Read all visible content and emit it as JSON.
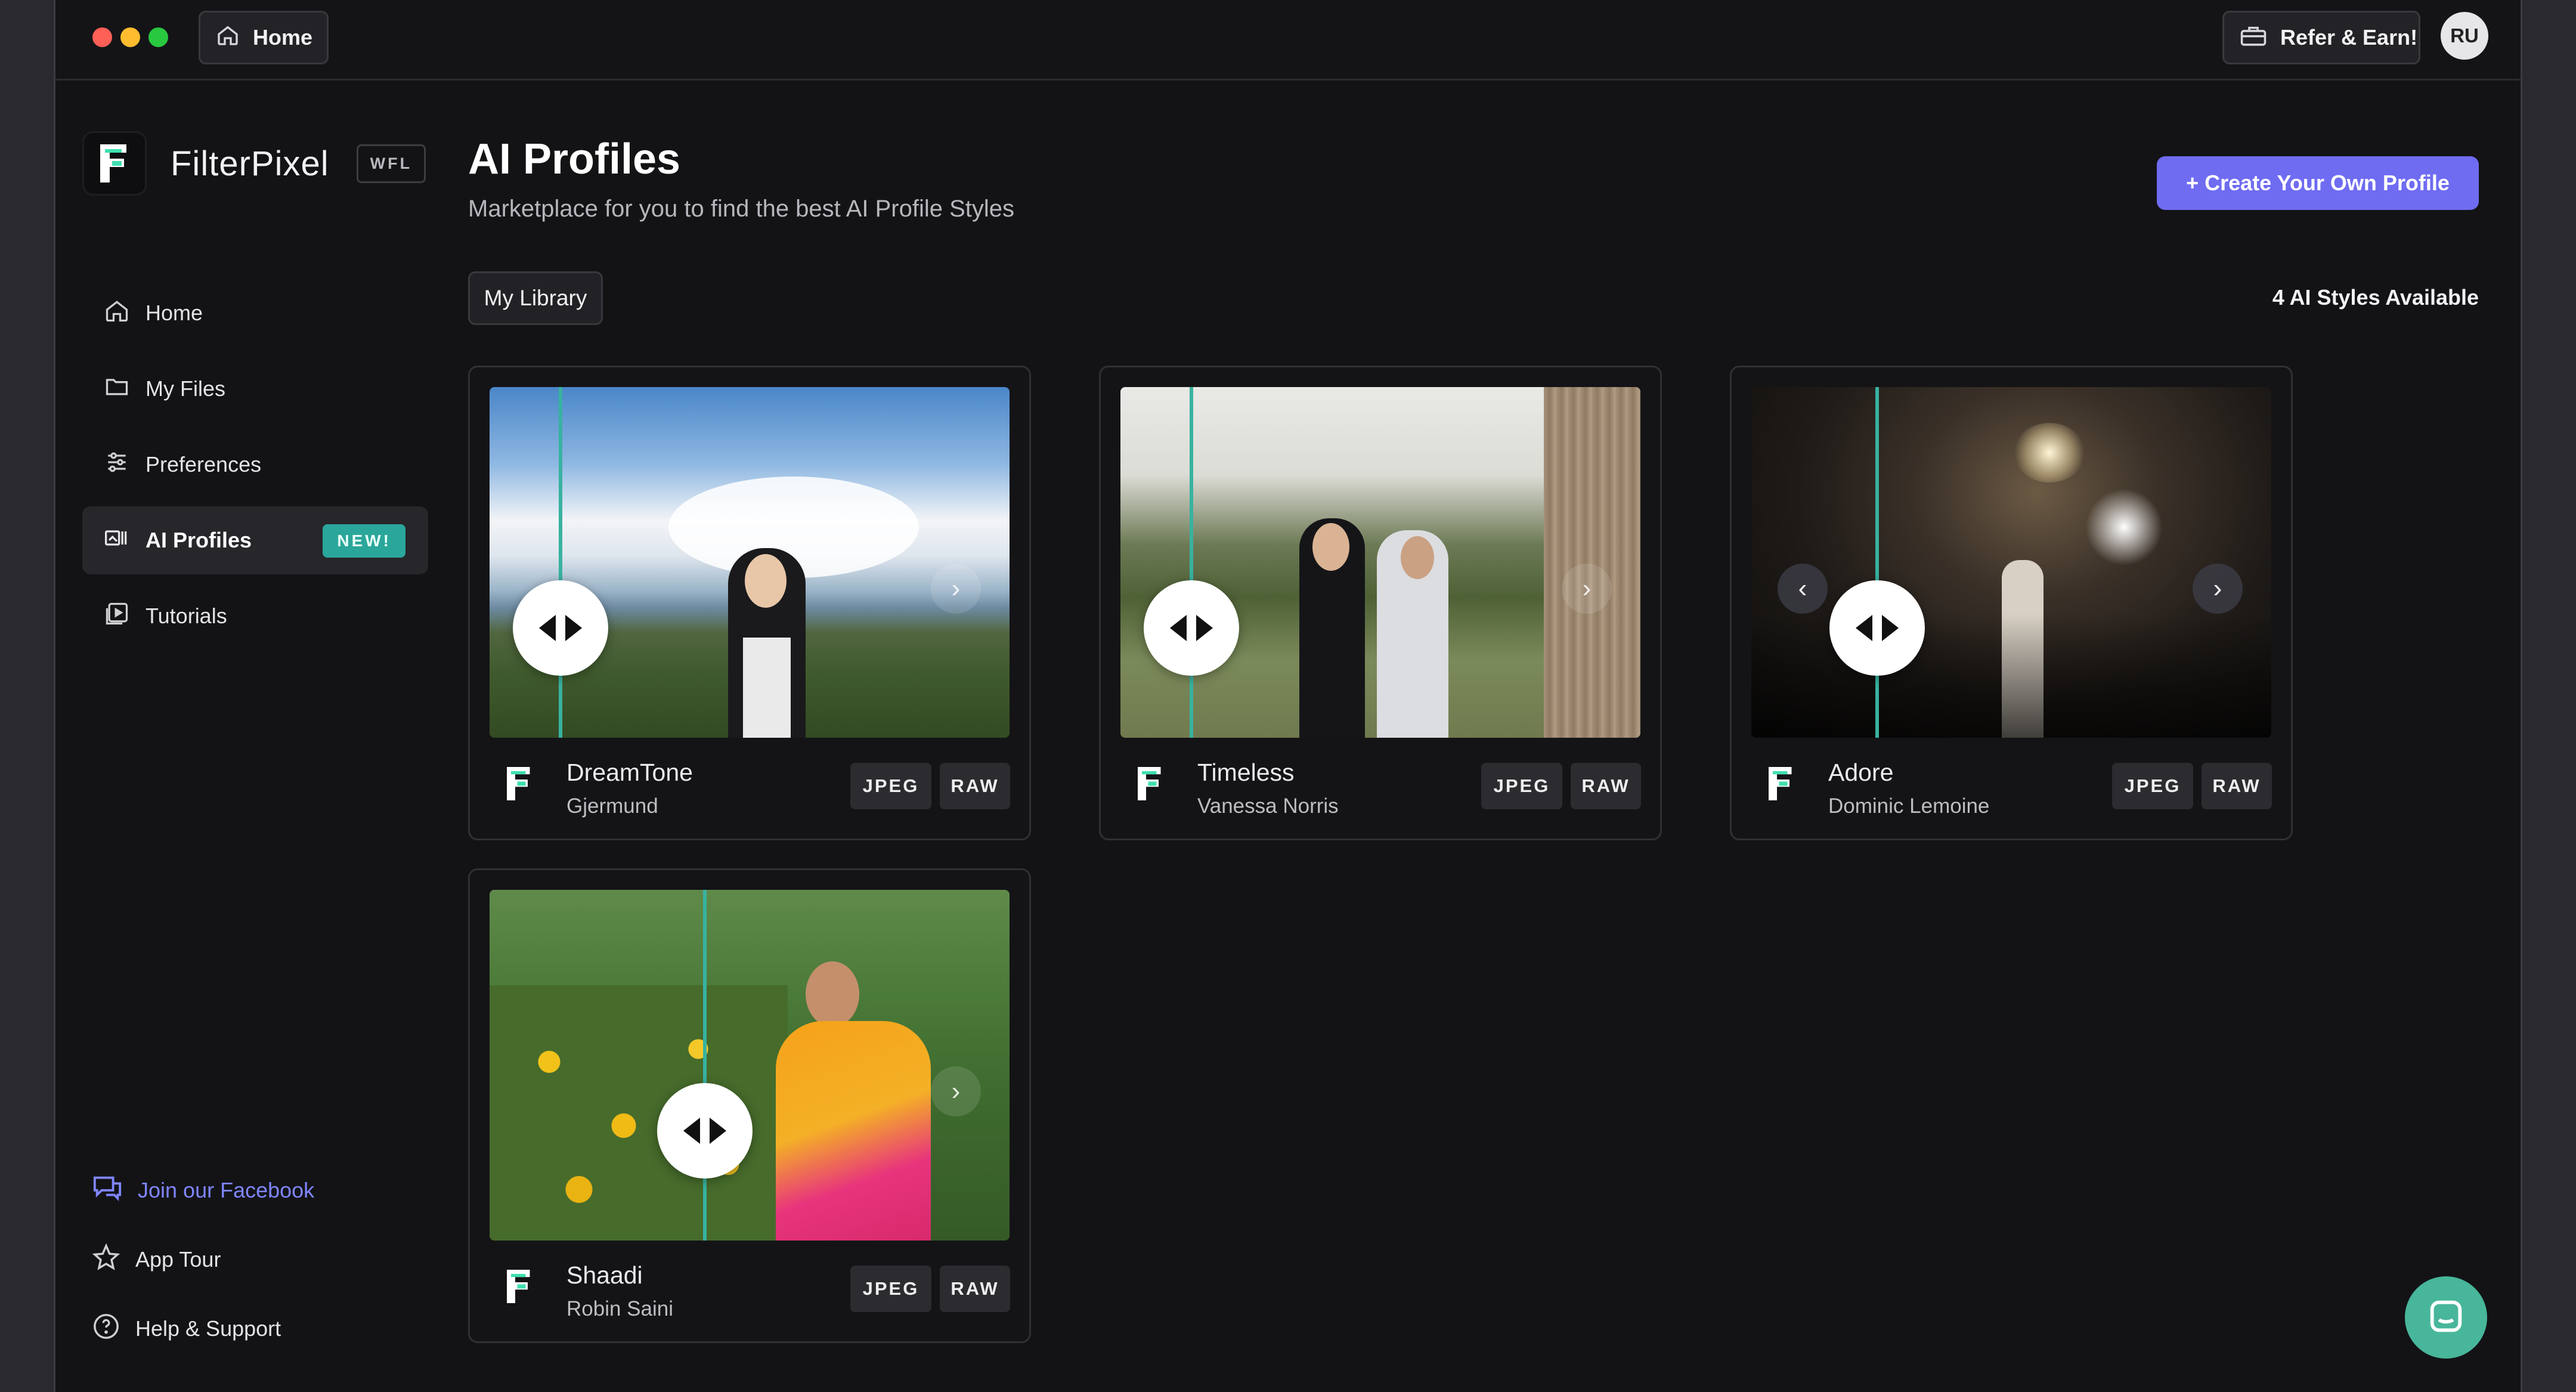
{
  "colors": {
    "accent": "#6f6cf2",
    "teal": "#2aa79a",
    "background": "#131316"
  },
  "topbar": {
    "home_tab": "Home",
    "refer": "Refer & Earn!",
    "avatar": "RU"
  },
  "brand": {
    "name": "FilterPixel",
    "tag": "WFL"
  },
  "sidebar": {
    "items": [
      {
        "label": "Home",
        "icon": "home-icon"
      },
      {
        "label": "My Files",
        "icon": "folder-icon"
      },
      {
        "label": "Preferences",
        "icon": "sliders-icon"
      },
      {
        "label": "AI Profiles",
        "icon": "gallery-icon",
        "badge": "NEW!",
        "active": true
      },
      {
        "label": "Tutorials",
        "icon": "play-icon"
      }
    ],
    "bottom": [
      {
        "label": "Join our Facebook",
        "icon": "chat-icon"
      },
      {
        "label": "App Tour",
        "icon": "star-icon"
      },
      {
        "label": "Help & Support",
        "icon": "help-icon"
      }
    ]
  },
  "main": {
    "title": "AI Profiles",
    "subtitle": "Marketplace for you to find the best AI Profile Styles",
    "create_button": "+ Create Your Own Profile",
    "library_button": "My Library",
    "available": "4 AI Styles Available"
  },
  "profiles": [
    {
      "name": "DreamTone",
      "author": "Gjermund",
      "formats": [
        "JPEG",
        "RAW"
      ]
    },
    {
      "name": "Timeless",
      "author": "Vanessa Norris",
      "formats": [
        "JPEG",
        "RAW"
      ]
    },
    {
      "name": "Adore",
      "author": "Dominic Lemoine",
      "formats": [
        "JPEG",
        "RAW"
      ]
    },
    {
      "name": "Shaadi",
      "author": "Robin Saini",
      "formats": [
        "JPEG",
        "RAW"
      ]
    }
  ]
}
